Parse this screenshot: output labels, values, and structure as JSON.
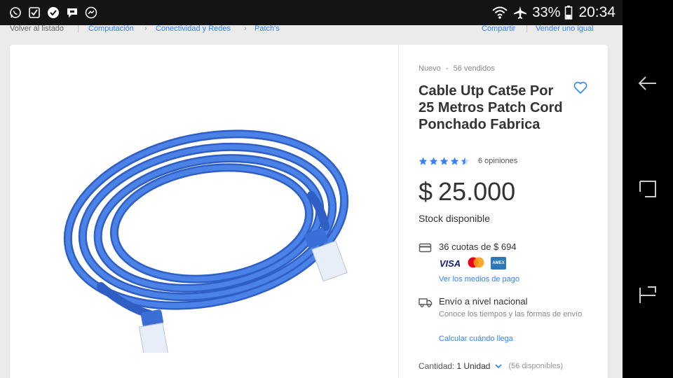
{
  "status_bar": {
    "notification_icons": [
      "whatsapp-icon",
      "checkbox-icon",
      "sync-icon",
      "chat-bubble-icon",
      "messenger-icon"
    ],
    "battery": "33%",
    "time": "20:34"
  },
  "breadcrumb": {
    "back": "Volver al listado",
    "items": [
      "Computación",
      "Conectividad y Redes",
      "Patch's"
    ],
    "share": "Compartir",
    "sell_similar": "Vender uno igual"
  },
  "product": {
    "condition": "Nuevo",
    "separator": "-",
    "sold": "56 vendidos",
    "title": "Cable Utp Cat5e Por 25 Metros Patch Cord Ponchado Fabrica",
    "rating": 4.5,
    "reviews": "6 opiniones",
    "price_symbol": "$",
    "price": "25.000",
    "stock": "Stock disponible"
  },
  "payment": {
    "installments": "36 cuotas de $ 694",
    "card_visa": "VISA",
    "card_amex": "AMERICAN EXPRESS",
    "link": "Ver los medios de pago"
  },
  "shipping": {
    "title": "Envío a nivel nacional",
    "description": "Conoce los tiempos y las formas de envío",
    "link": "Calcular cuándo llega"
  },
  "quantity": {
    "label": "Cantidad:",
    "value": "1 Unidad",
    "available": "(56 disponibles)"
  },
  "colors": {
    "accent": "#3483fa",
    "cable": "#3a6fd8",
    "star": "#3483fa"
  }
}
